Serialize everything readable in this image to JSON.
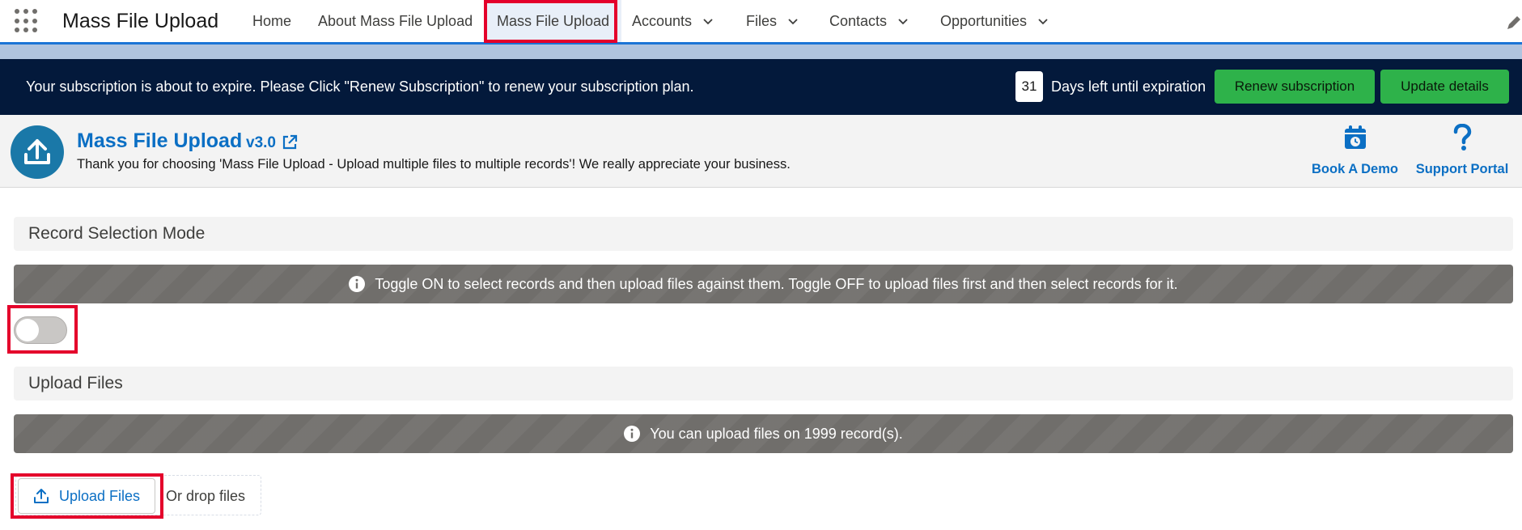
{
  "nav": {
    "app_name": "Mass File Upload",
    "items": [
      {
        "label": "Home"
      },
      {
        "label": "About Mass File Upload"
      },
      {
        "label": "Mass File Upload"
      },
      {
        "label": "Accounts"
      },
      {
        "label": "Files"
      },
      {
        "label": "Contacts"
      },
      {
        "label": "Opportunities"
      }
    ],
    "active_item": "Mass File Upload"
  },
  "subscription": {
    "message": "Your subscription is about to expire. Please Click \"Renew Subscription\" to renew your subscription plan.",
    "days_left": "31",
    "days_text": "Days left until expiration",
    "renew_label": "Renew subscription",
    "update_label": "Update details"
  },
  "app_header": {
    "title": "Mass File Upload",
    "version": "v3.0",
    "thanks": "Thank you for choosing 'Mass File Upload - Upload multiple files to multiple records'! We really appreciate your business.",
    "book_demo_label": "Book A Demo",
    "support_label": "Support Portal"
  },
  "record_selection": {
    "heading": "Record Selection Mode",
    "info": "Toggle ON to select records and then upload files against them. Toggle OFF to upload files first and then select records for it.",
    "toggle_on": false
  },
  "upload": {
    "heading": "Upload Files",
    "info": "You can upload files on 1999 record(s).",
    "button_label": "Upload Files",
    "drop_text": "Or drop files"
  },
  "colors": {
    "brand_blue": "#0b6fc4",
    "banner_navy": "#03193b",
    "green_button": "#2eb24a",
    "highlight_red": "#e4002b",
    "info_gray": "#706e6b"
  },
  "icons": [
    "app-launcher-icon",
    "chevron-down-icon",
    "edit-pencil-icon",
    "upload-icon",
    "external-link-icon",
    "calendar-clock-icon",
    "question-icon",
    "info-icon"
  ]
}
